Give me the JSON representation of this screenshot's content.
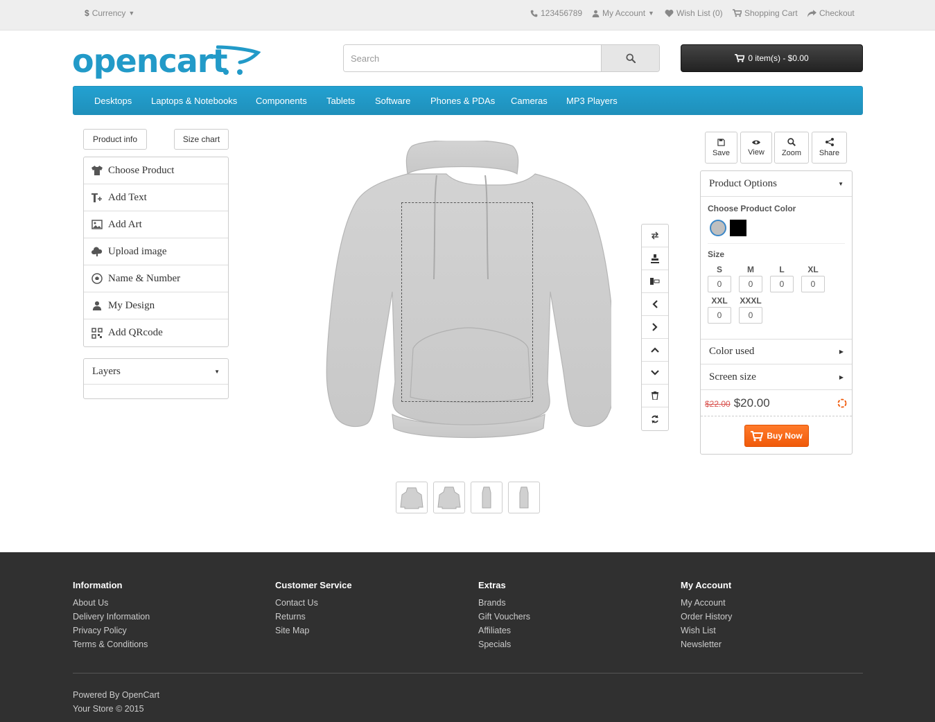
{
  "topbar": {
    "currency": "Currency",
    "phone": "123456789",
    "my_account": "My Account",
    "wish_list": "Wish List (0)",
    "shopping_cart": "Shopping Cart",
    "checkout": "Checkout"
  },
  "header": {
    "logo": "opencart",
    "search_placeholder": "Search",
    "cart_label": "0 item(s) - $0.00"
  },
  "menu": [
    "Desktops",
    "Laptops & Notebooks",
    "Components",
    "Tablets",
    "Software",
    "Phones & PDAs",
    "Cameras",
    "MP3 Players"
  ],
  "left_panel": {
    "product_info": "Product info",
    "size_chart": "Size chart",
    "tools": [
      {
        "label": "Choose Product",
        "icon": "tshirt-icon"
      },
      {
        "label": "Add Text",
        "icon": "text-icon"
      },
      {
        "label": "Add Art",
        "icon": "image-icon"
      },
      {
        "label": "Upload image",
        "icon": "cloud-upload-icon"
      },
      {
        "label": "Name & Number",
        "icon": "soccer-ball-icon"
      },
      {
        "label": "My Design",
        "icon": "user-icon"
      },
      {
        "label": "Add QRcode",
        "icon": "qrcode-icon"
      }
    ],
    "layers": "Layers"
  },
  "right_panel": {
    "actions": [
      {
        "label": "Save",
        "icon": "save-icon"
      },
      {
        "label": "View",
        "icon": "eye-icon"
      },
      {
        "label": "Zoom",
        "icon": "search-icon"
      },
      {
        "label": "Share",
        "icon": "share-icon"
      }
    ],
    "product_options": "Product Options",
    "choose_color": "Choose Product Color",
    "colors": [
      "#bfbfbf",
      "#000000"
    ],
    "size_label": "Size",
    "sizes": [
      {
        "name": "S",
        "qty": "0"
      },
      {
        "name": "M",
        "qty": "0"
      },
      {
        "name": "L",
        "qty": "0"
      },
      {
        "name": "XL",
        "qty": "0"
      },
      {
        "name": "XXL",
        "qty": "0"
      },
      {
        "name": "XXXL",
        "qty": "0"
      }
    ],
    "color_used": "Color used",
    "screen_size": "Screen size",
    "old_price": "$22.00",
    "price": "$20.00",
    "buy_now": "Buy Now"
  },
  "footer": {
    "columns": [
      {
        "title": "Information",
        "links": [
          "About Us",
          "Delivery Information",
          "Privacy Policy",
          "Terms & Conditions"
        ]
      },
      {
        "title": "Customer Service",
        "links": [
          "Contact Us",
          "Returns",
          "Site Map"
        ]
      },
      {
        "title": "Extras",
        "links": [
          "Brands",
          "Gift Vouchers",
          "Affiliates",
          "Specials"
        ]
      },
      {
        "title": "My Account",
        "links": [
          "My Account",
          "Order History",
          "Wish List",
          "Newsletter"
        ]
      }
    ],
    "powered_by": "Powered By",
    "powered_link": "OpenCart",
    "copyright": "Your Store © 2015"
  },
  "colors": {
    "brand": "#229ac8",
    "menu": "#229ac8",
    "buy": "#f26522",
    "footer": "#303030"
  }
}
